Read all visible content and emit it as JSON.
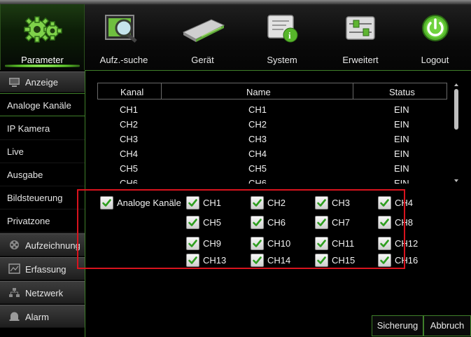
{
  "toolbar": {
    "items": [
      {
        "label": "Parameter",
        "icon": "gears-icon"
      },
      {
        "label": "Aufz.-suche",
        "icon": "film-search-icon"
      },
      {
        "label": "Gerät",
        "icon": "hard-drive-icon"
      },
      {
        "label": "System",
        "icon": "system-info-icon"
      },
      {
        "label": "Erweitert",
        "icon": "sliders-icon"
      },
      {
        "label": "Logout",
        "icon": "power-icon"
      }
    ]
  },
  "sidebar": {
    "items": [
      {
        "label": "Anzeige",
        "type": "section",
        "icon": "monitor-icon"
      },
      {
        "label": "Analoge Kanäle",
        "type": "sub"
      },
      {
        "label": "IP Kamera",
        "type": "sub"
      },
      {
        "label": "Live",
        "type": "sub"
      },
      {
        "label": "Ausgabe",
        "type": "sub"
      },
      {
        "label": "Bildsteuerung",
        "type": "sub"
      },
      {
        "label": "Privatzone",
        "type": "sub"
      },
      {
        "label": "Aufzeichnung",
        "type": "section",
        "icon": "reel-icon"
      },
      {
        "label": "Erfassung",
        "type": "section",
        "icon": "capture-icon"
      },
      {
        "label": "Netzwerk",
        "type": "section",
        "icon": "network-icon"
      },
      {
        "label": "Alarm",
        "type": "section",
        "icon": "alarm-bell-icon"
      }
    ]
  },
  "table": {
    "headers": [
      "Kanal",
      "Name",
      "Status"
    ],
    "rows": [
      [
        "CH1",
        "CH1",
        "EIN"
      ],
      [
        "CH2",
        "CH2",
        "EIN"
      ],
      [
        "CH3",
        "CH3",
        "EIN"
      ],
      [
        "CH4",
        "CH4",
        "EIN"
      ],
      [
        "CH5",
        "CH5",
        "EIN"
      ],
      [
        "CH6",
        "CH6",
        "EIN"
      ]
    ]
  },
  "channels": {
    "all_label": "Analoge Kanäle",
    "all_checked": true,
    "items": [
      {
        "label": "CH1",
        "checked": true
      },
      {
        "label": "CH2",
        "checked": true
      },
      {
        "label": "CH3",
        "checked": true
      },
      {
        "label": "CH4",
        "checked": true
      },
      {
        "label": "CH5",
        "checked": true
      },
      {
        "label": "CH6",
        "checked": true
      },
      {
        "label": "CH7",
        "checked": true
      },
      {
        "label": "CH8",
        "checked": true
      },
      {
        "label": "CH9",
        "checked": true
      },
      {
        "label": "CH10",
        "checked": true
      },
      {
        "label": "CH11",
        "checked": true
      },
      {
        "label": "CH12",
        "checked": true
      },
      {
        "label": "CH13",
        "checked": true
      },
      {
        "label": "CH14",
        "checked": true
      },
      {
        "label": "CH15",
        "checked": true
      },
      {
        "label": "CH16",
        "checked": true
      }
    ]
  },
  "buttons": {
    "backup": "Sicherung",
    "cancel": "Abbruch"
  },
  "colors": {
    "accent": "#3f7f2a",
    "highlight_box": "#d8131d",
    "check": "#2e9e1f"
  }
}
